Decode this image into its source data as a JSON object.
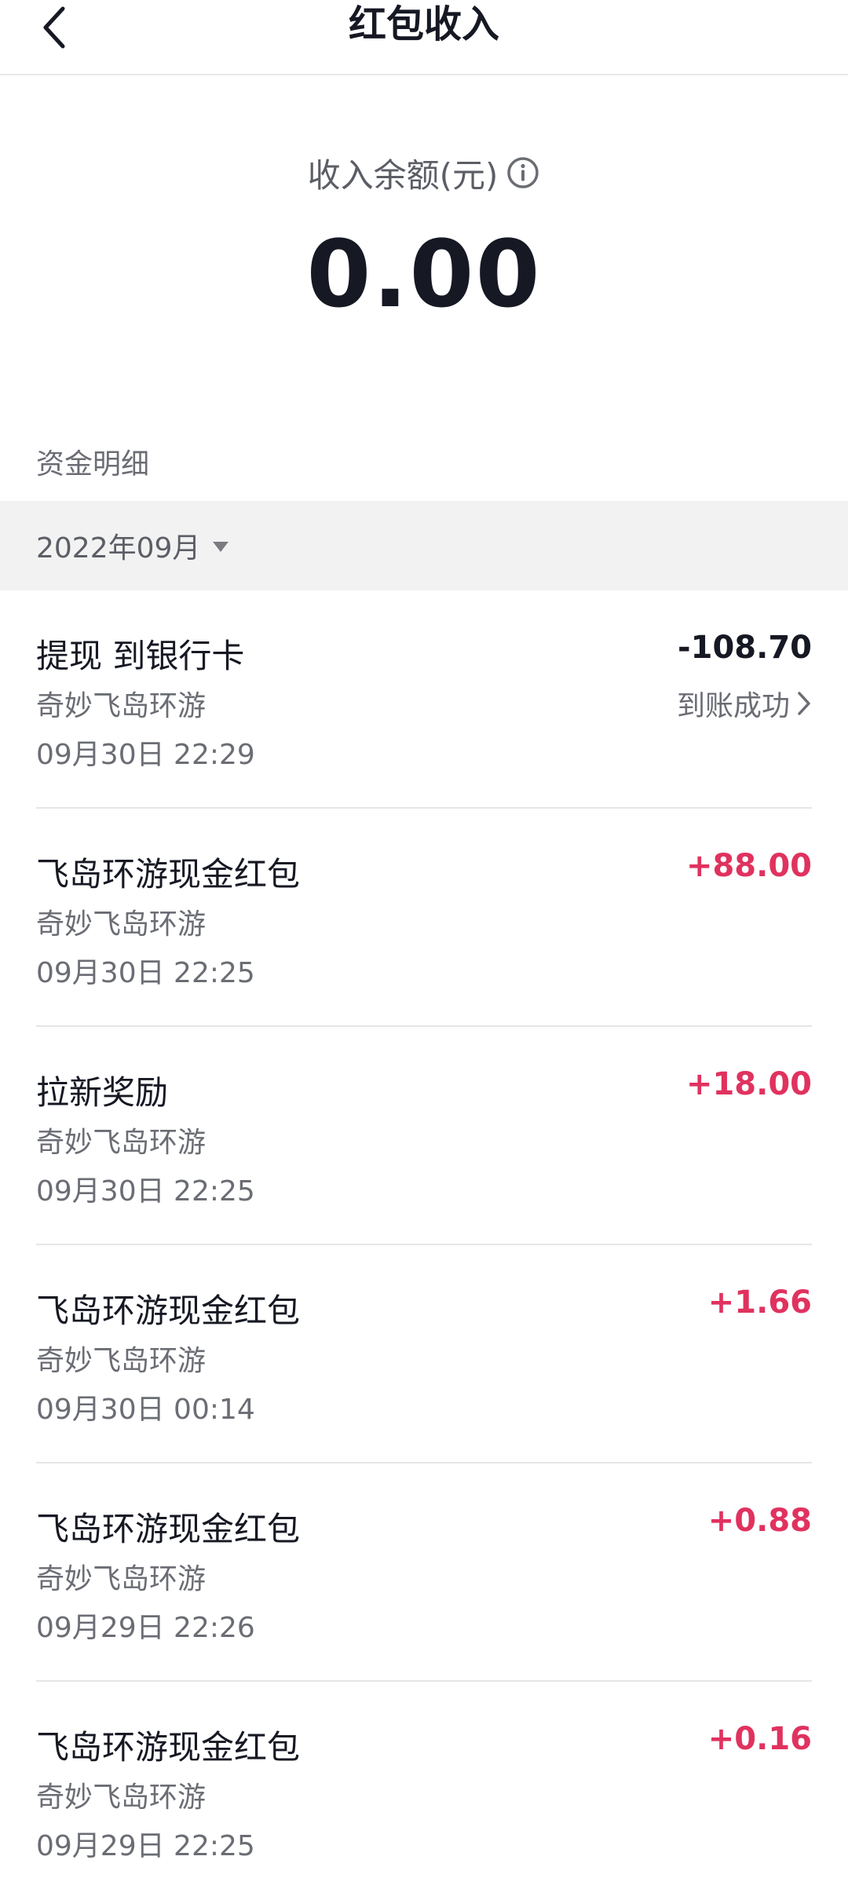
{
  "header": {
    "title": "红包收入"
  },
  "balance": {
    "label": "收入余额(元)",
    "amount": "0.00"
  },
  "section": {
    "title": "资金明细",
    "month": "2022年09月"
  },
  "transactions": [
    {
      "title": "提现 到银行卡",
      "source": "奇妙飞岛环游",
      "time": "09月30日 22:29",
      "amount": "-108.70",
      "status": "到账成功"
    },
    {
      "title": "飞岛环游现金红包",
      "source": "奇妙飞岛环游",
      "time": "09月30日 22:25",
      "amount": "+88.00"
    },
    {
      "title": "拉新奖励",
      "source": "奇妙飞岛环游",
      "time": "09月30日 22:25",
      "amount": "+18.00"
    },
    {
      "title": "飞岛环游现金红包",
      "source": "奇妙飞岛环游",
      "time": "09月30日 00:14",
      "amount": "+1.66"
    },
    {
      "title": "飞岛环游现金红包",
      "source": "奇妙飞岛环游",
      "time": "09月29日 22:26",
      "amount": "+0.88"
    },
    {
      "title": "飞岛环游现金红包",
      "source": "奇妙飞岛环游",
      "time": "09月29日 22:25",
      "amount": "+0.16"
    }
  ],
  "colors": {
    "positive": "#e0325f",
    "negative": "#161823",
    "secondary_text": "#6b6d74",
    "month_bar_bg": "#f2f2f3"
  },
  "icons": {
    "back": "chevron-left-icon",
    "info": "info-circle-icon",
    "month_caret": "caret-down-icon",
    "status_arrow": "chevron-right-icon"
  }
}
